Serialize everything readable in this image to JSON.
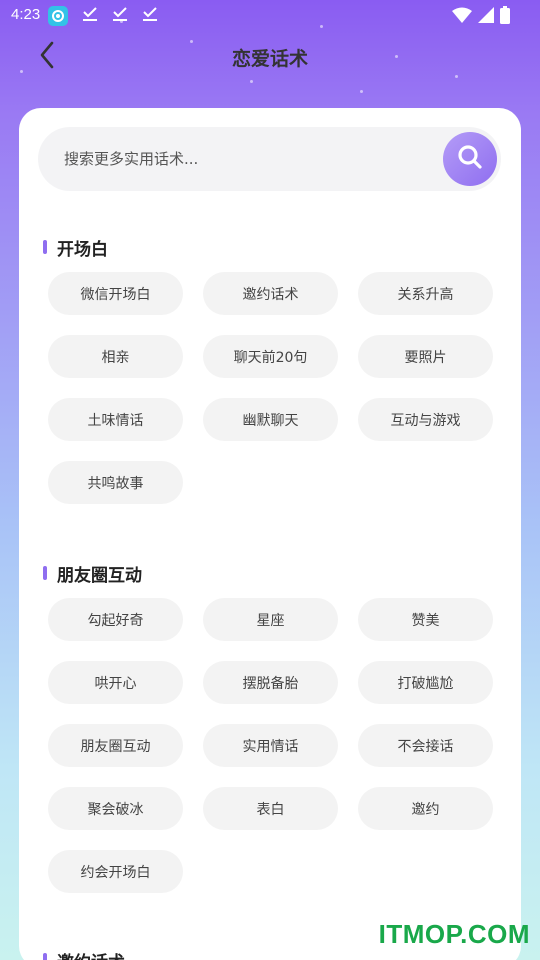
{
  "status": {
    "time": "4:23",
    "notif_icons": [
      "app-icon",
      "download-done-icon",
      "download-done-icon",
      "download-done-icon"
    ],
    "sys_icons": [
      "wifi-icon",
      "signal-icon",
      "battery-icon"
    ]
  },
  "nav": {
    "title": "恋爱话术",
    "back_icon": "chevron-left-icon"
  },
  "search": {
    "placeholder": "搜索更多实用话术...",
    "value": ""
  },
  "sections": [
    {
      "title": "开场白",
      "tags": [
        "微信开场白",
        "邀约话术",
        "关系升高",
        "相亲",
        "聊天前20句",
        "要照片",
        "土味情话",
        "幽默聊天",
        "互动与游戏",
        "共鸣故事"
      ]
    },
    {
      "title": "朋友圈互动",
      "tags": [
        "勾起好奇",
        "星座",
        "赞美",
        "哄开心",
        "摆脱备胎",
        "打破尴尬",
        "朋友圈互动",
        "实用情话",
        "不会接话",
        "聚会破冰",
        "表白",
        "邀约",
        "约会开场白"
      ]
    },
    {
      "title": "邀约话术",
      "tags": []
    }
  ],
  "watermark": "ITMOP.COM",
  "colors": {
    "accent": "#8f6ef0",
    "tag_bg": "#f3f3f3",
    "watermark": "#19a84a"
  }
}
